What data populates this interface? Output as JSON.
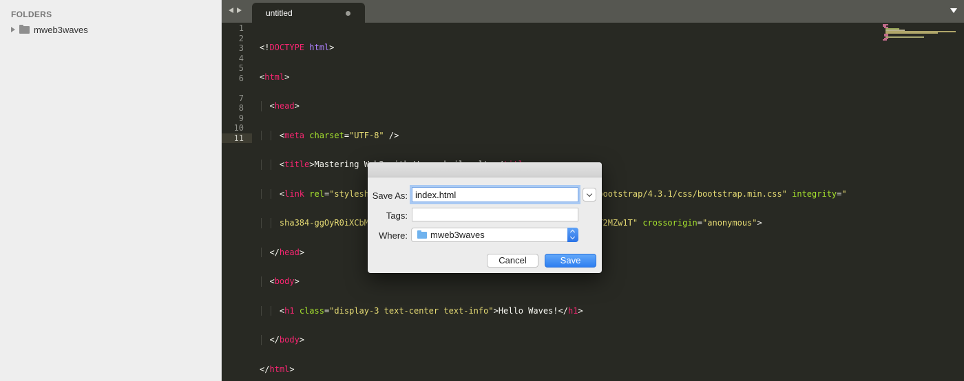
{
  "sidebar": {
    "header": "FOLDERS",
    "folder": "mweb3waves"
  },
  "tabbar": {
    "tab_title": "untitled"
  },
  "editor": {
    "line_numbers": [
      "1",
      "2",
      "3",
      "4",
      "5",
      "6",
      "",
      "7",
      "8",
      "9",
      "10",
      "11"
    ],
    "active_line": "11",
    "code": {
      "l1_doctype": "DOCTYPE",
      "l1_html": "html",
      "l2_html": "html",
      "l3_head": "head",
      "l4_meta": "meta",
      "l4_attr": "charset",
      "l4_val": "\"UTF-8\"",
      "l5_title": "title",
      "l5_text": "Mastering Web3 with Waves boilerplte",
      "l6_link": "link",
      "l6_rel": "rel",
      "l6_rel_val": "\"stylesheet\"",
      "l6_href": "href",
      "l6_href_val": "\"https://stackpath.bootstrapcdn.com/bootstrap/4.3.1/css/bootstrap.min.css\"",
      "l6_integrity": "integrity",
      "l6_integrity_open": "\"",
      "l6b_integrity_val": "sha384-ggOyR0iXCbMQv3Xipma34MD+dH/1fQ784/j6cY/iJTQUOhcWr7x9JvoRxT2MZw1T\"",
      "l6b_crossorigin": "crossorigin",
      "l6b_crossorigin_val": "\"anonymous\"",
      "l7_head": "head",
      "l8_body": "body",
      "l9_h1": "h1",
      "l9_class": "class",
      "l9_class_val": "\"display-3 text-center text-info\"",
      "l9_text": "Hello Waves!",
      "l9_h1_close": "h1",
      "l10_body": "body",
      "l11_html": "html"
    }
  },
  "dialog": {
    "save_as_label": "Save As:",
    "save_as_value": "index.html",
    "tags_label": "Tags:",
    "tags_value": "",
    "where_label": "Where:",
    "where_value": "mweb3waves",
    "cancel_label": "Cancel",
    "save_label": "Save"
  },
  "colors": {
    "editor_bg": "#282923",
    "tag": "#f92672",
    "attribute": "#a6e22e",
    "string": "#e6db74",
    "keyword": "#ae81ff",
    "accent_blue": "#2e7ef0"
  }
}
